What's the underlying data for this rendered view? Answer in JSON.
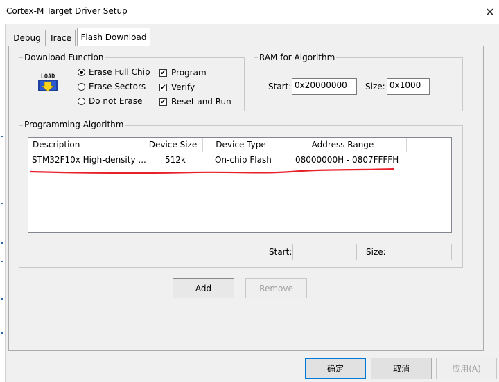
{
  "window": {
    "title": "Cortex-M Target Driver Setup",
    "close_glyph": "✕"
  },
  "tabs": [
    {
      "label": "Debug"
    },
    {
      "label": "Trace"
    },
    {
      "label": "Flash Download"
    }
  ],
  "download_function": {
    "group_label": "Download Function",
    "icon_text": "LOAD",
    "erase_options": [
      {
        "label": "Erase Full Chip",
        "selected": true
      },
      {
        "label": "Erase Sectors",
        "selected": false
      },
      {
        "label": "Do not Erase",
        "selected": false
      }
    ],
    "checkboxes": [
      {
        "label": "Program",
        "checked": true
      },
      {
        "label": "Verify",
        "checked": true
      },
      {
        "label": "Reset and Run",
        "checked": true
      }
    ],
    "check_glyph": "✔"
  },
  "ram": {
    "group_label": "RAM for Algorithm",
    "start_label": "Start:",
    "start_value": "0x20000000",
    "size_label": "Size:",
    "size_value": "0x1000"
  },
  "programming_algorithm": {
    "group_label": "Programming Algorithm",
    "columns": [
      "Description",
      "Device Size",
      "Device Type",
      "Address Range"
    ],
    "rows": [
      {
        "description": "STM32F10x High-density ...",
        "device_size": "512k",
        "device_type": "On-chip Flash",
        "address_range": "08000000H - 0807FFFFH"
      }
    ],
    "start_label": "Start:",
    "start_value": "",
    "size_label": "Size:",
    "size_value": "",
    "annotation_color": "#e8202a"
  },
  "buttons": {
    "add": "Add",
    "remove": "Remove",
    "ok": "确定",
    "cancel": "取消",
    "apply": "应用(A)"
  },
  "colors": {
    "accent": "#0078d7",
    "annotation": "#e8202a"
  }
}
